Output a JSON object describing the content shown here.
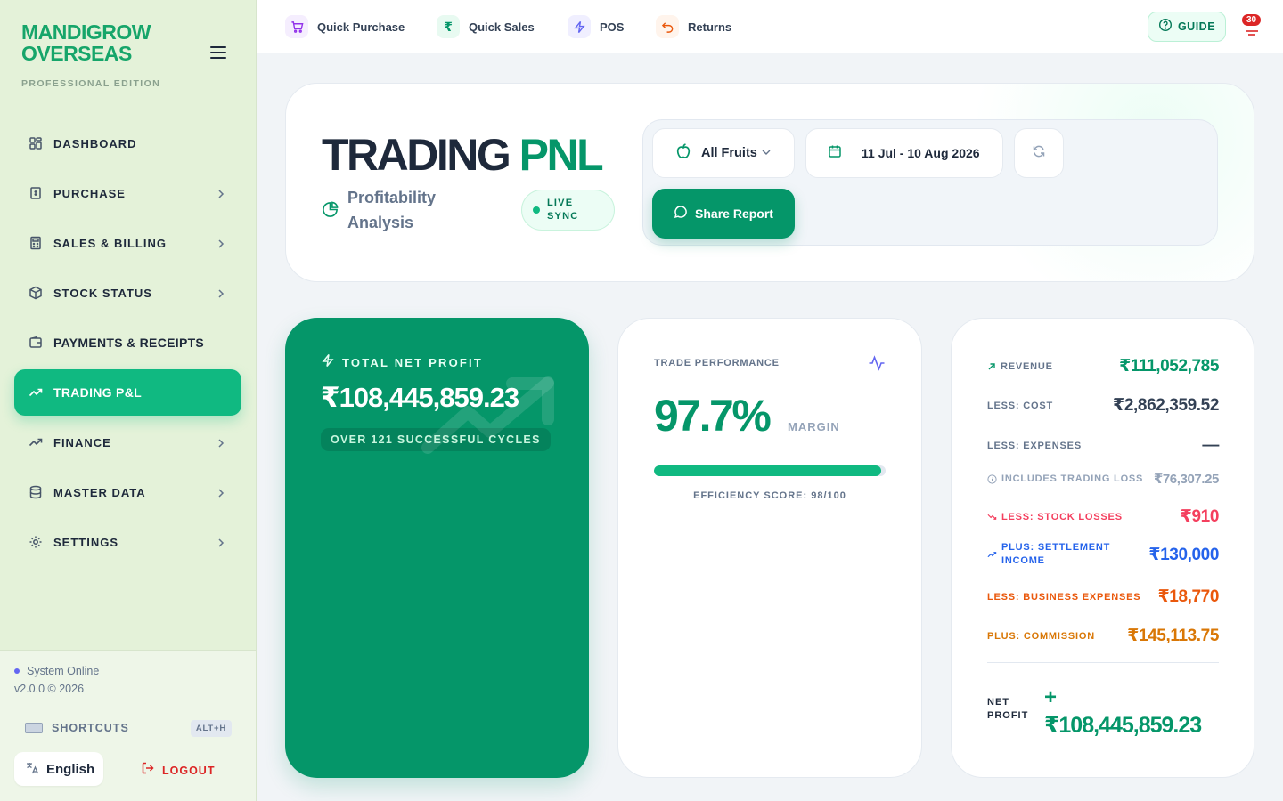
{
  "brand": {
    "name": "MANDIGROW OVERSEAS",
    "edition": "PROFESSIONAL EDITION"
  },
  "sidebar": {
    "items": [
      {
        "label": "DASHBOARD",
        "icon": "grid-icon",
        "expandable": false,
        "active": false
      },
      {
        "label": "PURCHASE",
        "icon": "receipt-icon",
        "expandable": true,
        "active": false
      },
      {
        "label": "SALES & BILLING",
        "icon": "calculator-icon",
        "expandable": true,
        "active": false
      },
      {
        "label": "STOCK STATUS",
        "icon": "box-icon",
        "expandable": true,
        "active": false
      },
      {
        "label": "PAYMENTS & RECEIPTS",
        "icon": "wallet-icon",
        "expandable": false,
        "active": false
      },
      {
        "label": "TRADING P&L",
        "icon": "trend-icon",
        "expandable": false,
        "active": true
      },
      {
        "label": "FINANCE",
        "icon": "trend-icon",
        "expandable": true,
        "active": false
      },
      {
        "label": "MASTER DATA",
        "icon": "database-icon",
        "expandable": true,
        "active": false
      },
      {
        "label": "SETTINGS",
        "icon": "gear-icon",
        "expandable": true,
        "active": false
      }
    ],
    "status": "System Online",
    "version": "v2.0.0 © 2026",
    "shortcuts_label": "SHORTCUTS",
    "shortcuts_key": "ALT+H",
    "language": "English",
    "logout_label": "LOGOUT"
  },
  "topbar": {
    "quick_purchase": "Quick Purchase",
    "quick_sales": "Quick Sales",
    "pos": "POS",
    "returns": "Returns",
    "guide": "GUIDE",
    "notification_count": "30",
    "rupee_glyph": "₹"
  },
  "header": {
    "title_main": "TRADING",
    "title_accent": "PNL",
    "subtitle": "Profitability Analysis",
    "live_badge": "LIVE SYNC",
    "fruit_filter": "All Fruits",
    "date_range": "11 Jul - 10 Aug 2026",
    "share_label": "Share Report"
  },
  "profit_card": {
    "label": "TOTAL NET PROFIT",
    "value": "₹108,445,859.23",
    "cycles": "OVER 121 SUCCESSFUL CYCLES"
  },
  "performance_card": {
    "label": "TRADE PERFORMANCE",
    "margin_value": "97.7%",
    "margin_unit": "MARGIN",
    "efficiency_fraction": 0.98,
    "efficiency_text": "EFFICIENCY SCORE: 98/100"
  },
  "breakdown": {
    "revenue": {
      "label": "REVENUE",
      "value": "₹111,052,785"
    },
    "cost": {
      "label": "LESS: COST",
      "value": "₹2,862,359.52"
    },
    "expenses": {
      "label": "LESS: EXPENSES",
      "value": "—"
    },
    "trading_loss": {
      "label": "INCLUDES TRADING LOSS",
      "value": "₹76,307.25"
    },
    "stock_losses": {
      "label": "LESS: STOCK LOSSES",
      "value": "₹910"
    },
    "settlement": {
      "label": "PLUS: SETTLEMENT INCOME",
      "value": "₹130,000"
    },
    "business_expenses": {
      "label": "LESS: BUSINESS EXPENSES",
      "value": "₹18,770"
    },
    "commission": {
      "label": "PLUS: COMMISSION",
      "value": "₹145,113.75"
    },
    "net_profit_label": "NET PROFIT",
    "net_profit_sign": "+",
    "net_profit_value": "₹108,445,859.23"
  },
  "colors": {
    "brand_green": "#059669",
    "accent_green": "#10b981",
    "revenue": "#059669",
    "stock_losses": "#f43f5e",
    "settlement": "#2563eb",
    "business_expenses": "#ea580c",
    "commission": "#d97706"
  }
}
